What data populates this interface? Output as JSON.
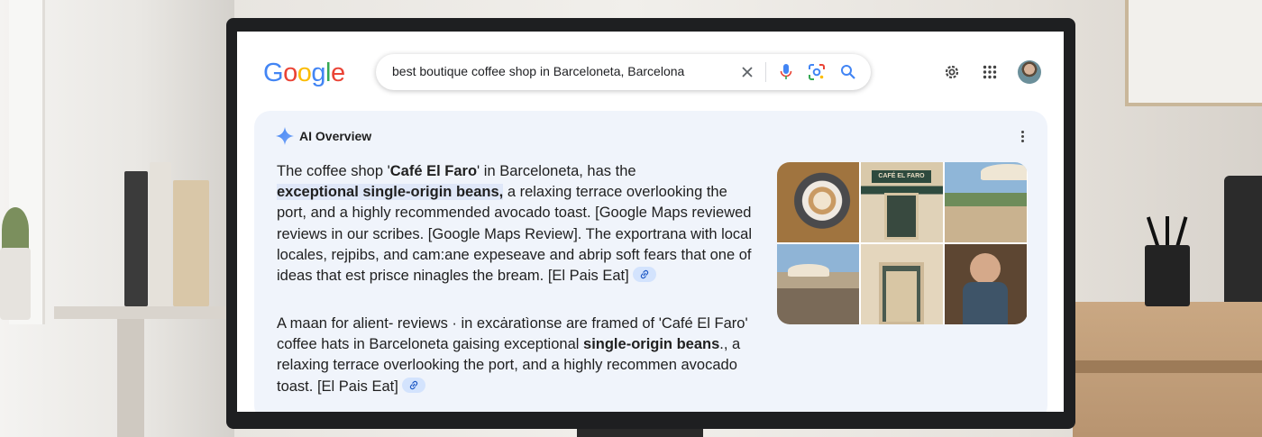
{
  "logo": {
    "letters": [
      "G",
      "o",
      "o",
      "g",
      "l",
      "e"
    ],
    "colors": [
      "#4285F4",
      "#EA4335",
      "#FBBC05",
      "#4285F4",
      "#34A853",
      "#EA4335"
    ]
  },
  "search": {
    "query": "best boutique coffee shop in Barceloneta, Barcelona"
  },
  "header": {
    "icons": [
      "settings-icon",
      "apps-grid-icon",
      "avatar"
    ]
  },
  "ai_overview": {
    "title": "AI Overview",
    "p1": {
      "a": "The coffee shop '",
      "b_name": "Café El Faro",
      "c": "' in Barceloneta, has the",
      "d_bold": "exceptional single-origin beans,",
      "e": " a relaxing terrace overlooking the port, and a highly recommended avocado toast. [Google Maps reviewed reviews in our scribes. [Google Maps Review]. The exportrana with local locales, rejpibs, and cam:ane expeseave and abrip soft fears that one of ideas that est prisce ninagles the bream. [El Pais Eat]"
    },
    "p2": {
      "a": "A maan for alient- reviews · in excȧratìonse are framed of 'Café El Faro'    coffee hats in Barceloneta gaising exceptional ",
      "b_bold": "single-origin beans",
      "c": "., a relaxing terrace overlooking the port, and a highly recommen avocado toast. [El Pais Eat]"
    },
    "images": [
      "latte-art",
      "cafe-el-faro-storefront",
      "terrace-sea-view",
      "port-terrace",
      "shop-entrance",
      "barista"
    ],
    "storefront_sign": "CAFÉ EL FARO"
  }
}
